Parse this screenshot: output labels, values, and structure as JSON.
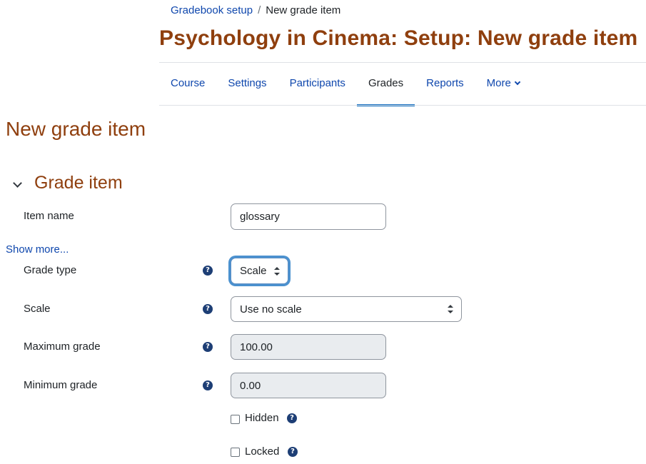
{
  "breadcrumb": {
    "parent": "Gradebook setup",
    "separator": "/",
    "current": "New grade item"
  },
  "page_heading": "Psychology in Cinema: Setup: New grade item",
  "nav": {
    "tabs": [
      "Course",
      "Settings",
      "Participants",
      "Grades",
      "Reports",
      "More"
    ],
    "active": "Grades"
  },
  "form_title": "New grade item",
  "section": {
    "title": "Grade item"
  },
  "fields": {
    "item_name": {
      "label": "Item name",
      "value": "glossary"
    },
    "show_more": "Show more...",
    "grade_type": {
      "label": "Grade type",
      "value": "Scale"
    },
    "scale": {
      "label": "Scale",
      "value": "Use no scale"
    },
    "maximum_grade": {
      "label": "Maximum grade",
      "value": "100.00"
    },
    "minimum_grade": {
      "label": "Minimum grade",
      "value": "0.00"
    },
    "hidden": {
      "label": "Hidden",
      "checked": false
    },
    "locked": {
      "label": "Locked",
      "checked": false
    }
  },
  "help_icon": "?",
  "colors": {
    "heading": "#8f3f0e",
    "link": "#0f47ad",
    "accent": "#0f6cbf",
    "help_icon": "#1d3e75"
  }
}
